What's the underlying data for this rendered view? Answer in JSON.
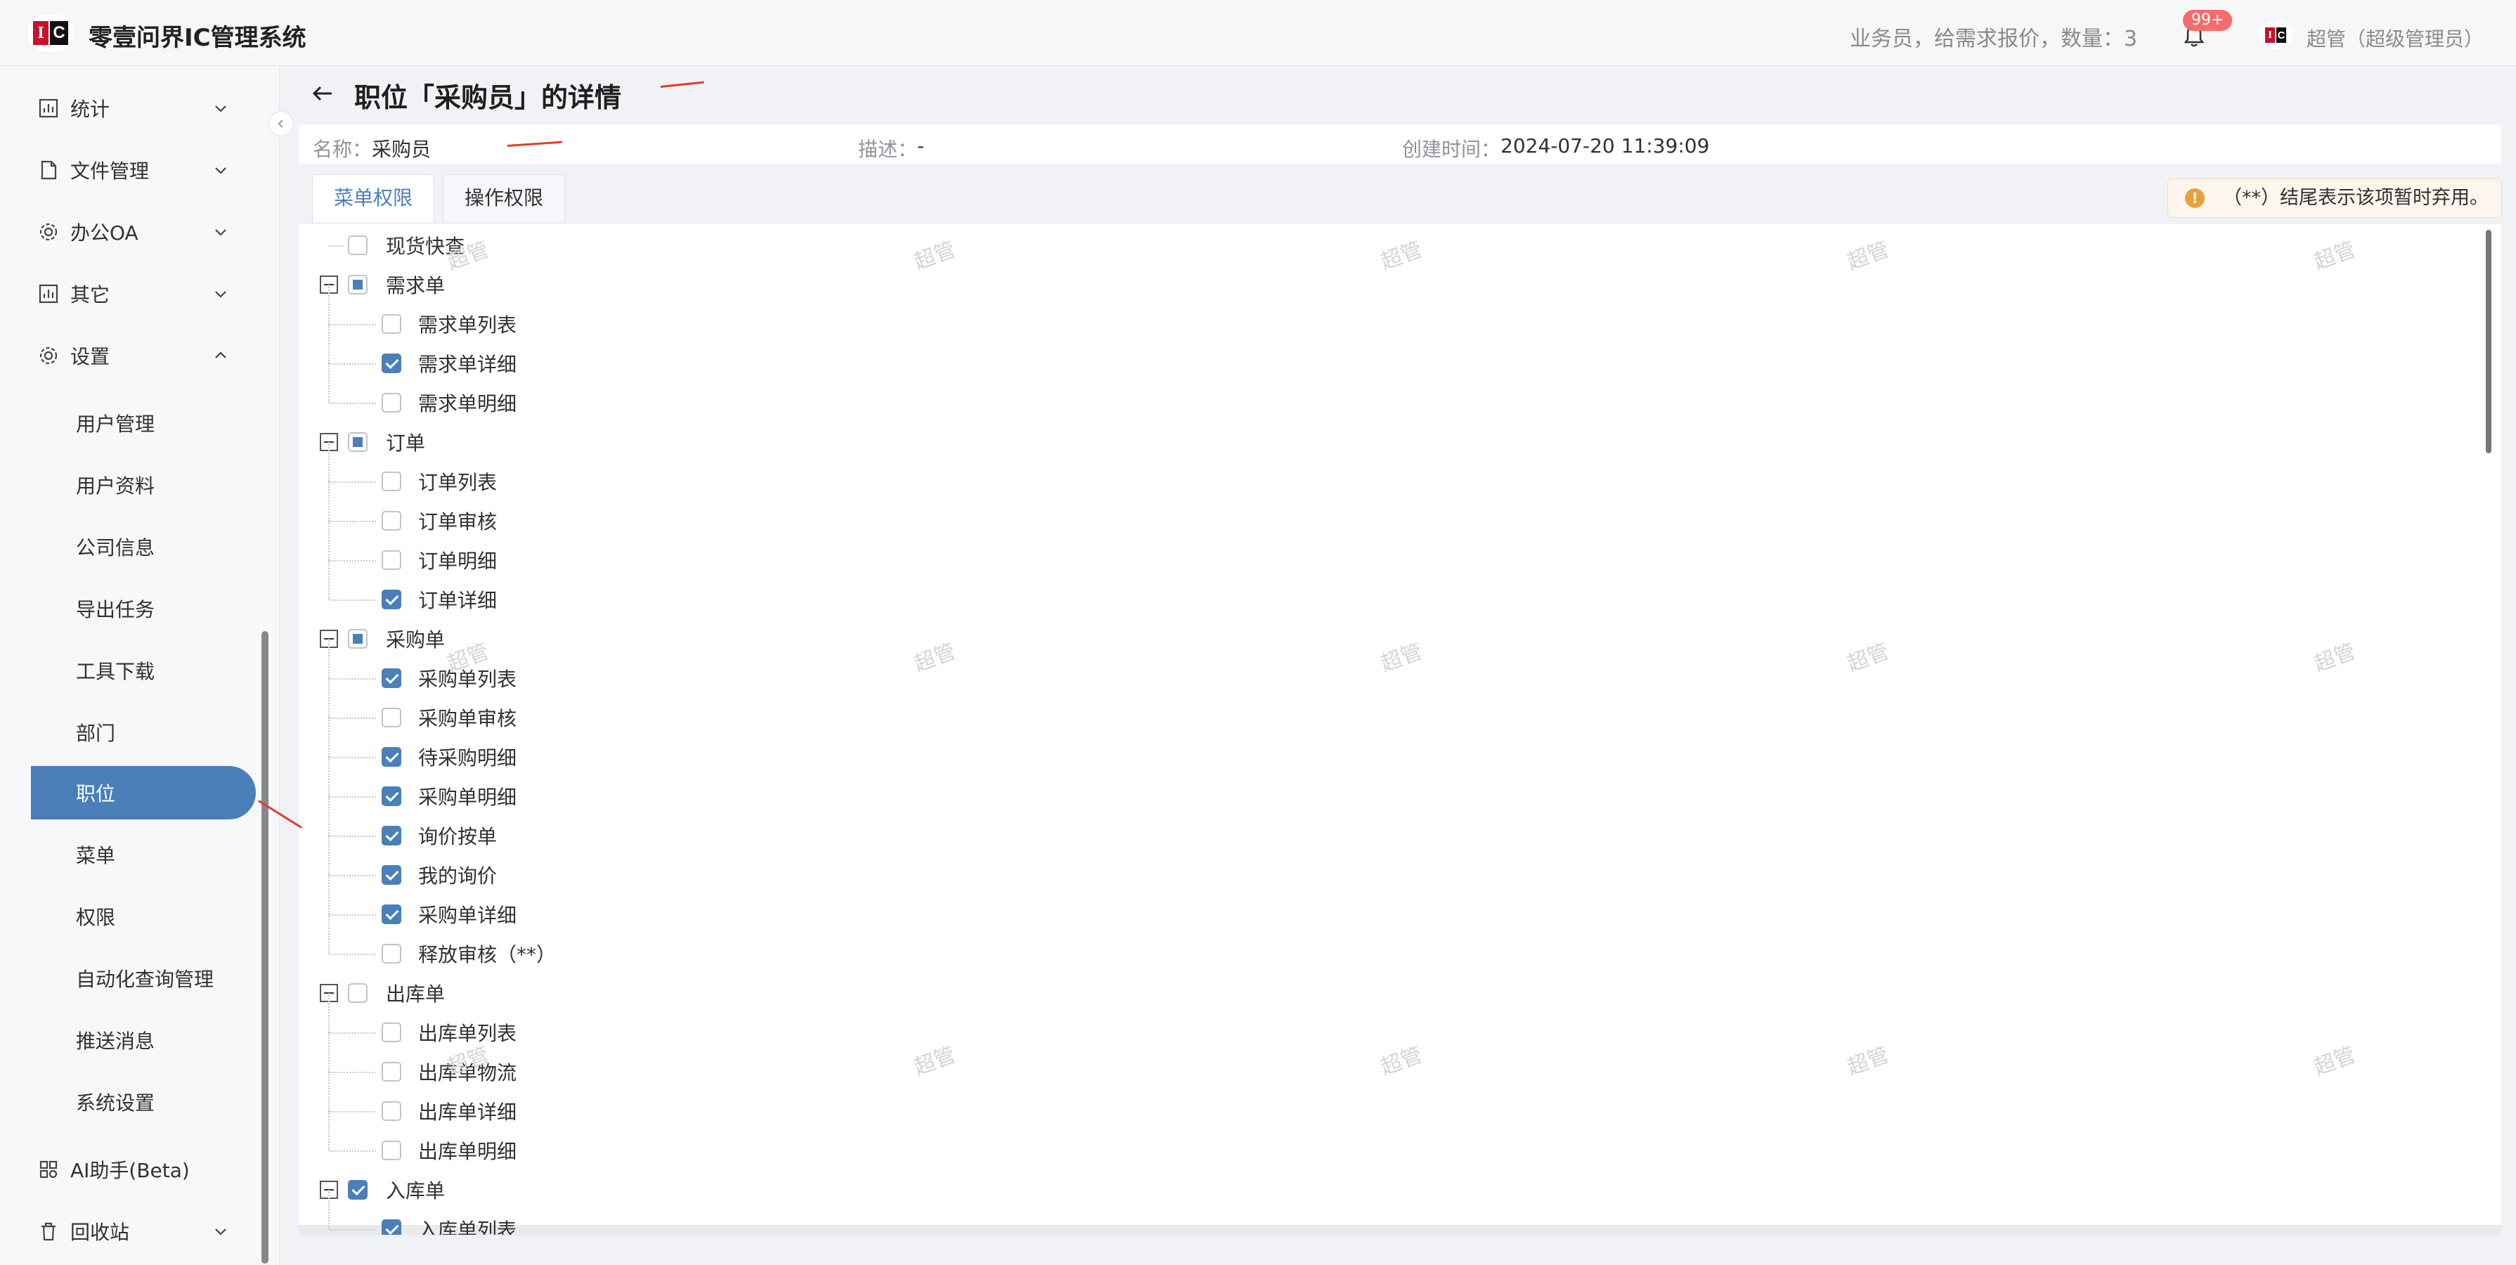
{
  "header": {
    "logo_i": "I",
    "logo_c": "C",
    "title": "零壹问界IC管理系统",
    "notice": "业务员，给需求报价，数量：3",
    "badge": "99+",
    "user": "超管（超级管理员）"
  },
  "sidebar": {
    "top_items": [
      {
        "label": "统计"
      },
      {
        "label": "文件管理"
      },
      {
        "label": "办公OA"
      },
      {
        "label": "其它"
      },
      {
        "label": "设置"
      }
    ],
    "sub_items": [
      {
        "label": "用户管理"
      },
      {
        "label": "用户资料"
      },
      {
        "label": "公司信息"
      },
      {
        "label": "导出任务"
      },
      {
        "label": "工具下载"
      },
      {
        "label": "部门"
      },
      {
        "label": "职位"
      },
      {
        "label": "菜单"
      },
      {
        "label": "权限"
      },
      {
        "label": "自动化查询管理"
      },
      {
        "label": "推送消息"
      },
      {
        "label": "系统设置"
      }
    ],
    "bottom_items": [
      {
        "label": "AI助手(Beta)"
      },
      {
        "label": "回收站"
      }
    ]
  },
  "page": {
    "title": "职位「采购员」的详情",
    "name_label": "名称：",
    "name_value": "采购员",
    "desc_label": "描述：",
    "desc_value": "-",
    "created_label": "创建时间：",
    "created_value": "2024-07-20 11:39:09",
    "tabs": [
      "菜单权限",
      "操作权限"
    ],
    "warning": "（**）结尾表示该项暂时弃用。",
    "watermark": "超管"
  },
  "tree": [
    {
      "label": "现货快查",
      "level": 0,
      "state": "unchecked"
    },
    {
      "label": "需求单",
      "level": 0,
      "state": "partial",
      "expandable": true
    },
    {
      "label": "需求单列表",
      "level": 1,
      "state": "unchecked"
    },
    {
      "label": "需求单详细",
      "level": 1,
      "state": "checked"
    },
    {
      "label": "需求单明细",
      "level": 1,
      "state": "unchecked"
    },
    {
      "label": "订单",
      "level": 0,
      "state": "partial",
      "expandable": true
    },
    {
      "label": "订单列表",
      "level": 1,
      "state": "unchecked"
    },
    {
      "label": "订单审核",
      "level": 1,
      "state": "unchecked"
    },
    {
      "label": "订单明细",
      "level": 1,
      "state": "unchecked"
    },
    {
      "label": "订单详细",
      "level": 1,
      "state": "checked"
    },
    {
      "label": "采购单",
      "level": 0,
      "state": "partial",
      "expandable": true
    },
    {
      "label": "采购单列表",
      "level": 1,
      "state": "checked"
    },
    {
      "label": "采购单审核",
      "level": 1,
      "state": "unchecked"
    },
    {
      "label": "待采购明细",
      "level": 1,
      "state": "checked"
    },
    {
      "label": "采购单明细",
      "level": 1,
      "state": "checked"
    },
    {
      "label": "询价按单",
      "level": 1,
      "state": "checked"
    },
    {
      "label": "我的询价",
      "level": 1,
      "state": "checked"
    },
    {
      "label": "采购单详细",
      "level": 1,
      "state": "checked"
    },
    {
      "label": "释放审核（**）",
      "level": 1,
      "state": "unchecked"
    },
    {
      "label": "出库单",
      "level": 0,
      "state": "unchecked",
      "expandable": true
    },
    {
      "label": "出库单列表",
      "level": 1,
      "state": "unchecked"
    },
    {
      "label": "出库单物流",
      "level": 1,
      "state": "unchecked"
    },
    {
      "label": "出库单详细",
      "level": 1,
      "state": "unchecked"
    },
    {
      "label": "出库单明细",
      "level": 1,
      "state": "unchecked"
    },
    {
      "label": "入库单",
      "level": 0,
      "state": "checked",
      "expandable": true
    },
    {
      "label": "入库单列表",
      "level": 1,
      "state": "checked"
    }
  ],
  "colors": {
    "accent": "#4a7fba",
    "annotation_arrow": "#e23b2e",
    "warning_bg": "#fdf6ec",
    "badge": "#f56c6c"
  }
}
